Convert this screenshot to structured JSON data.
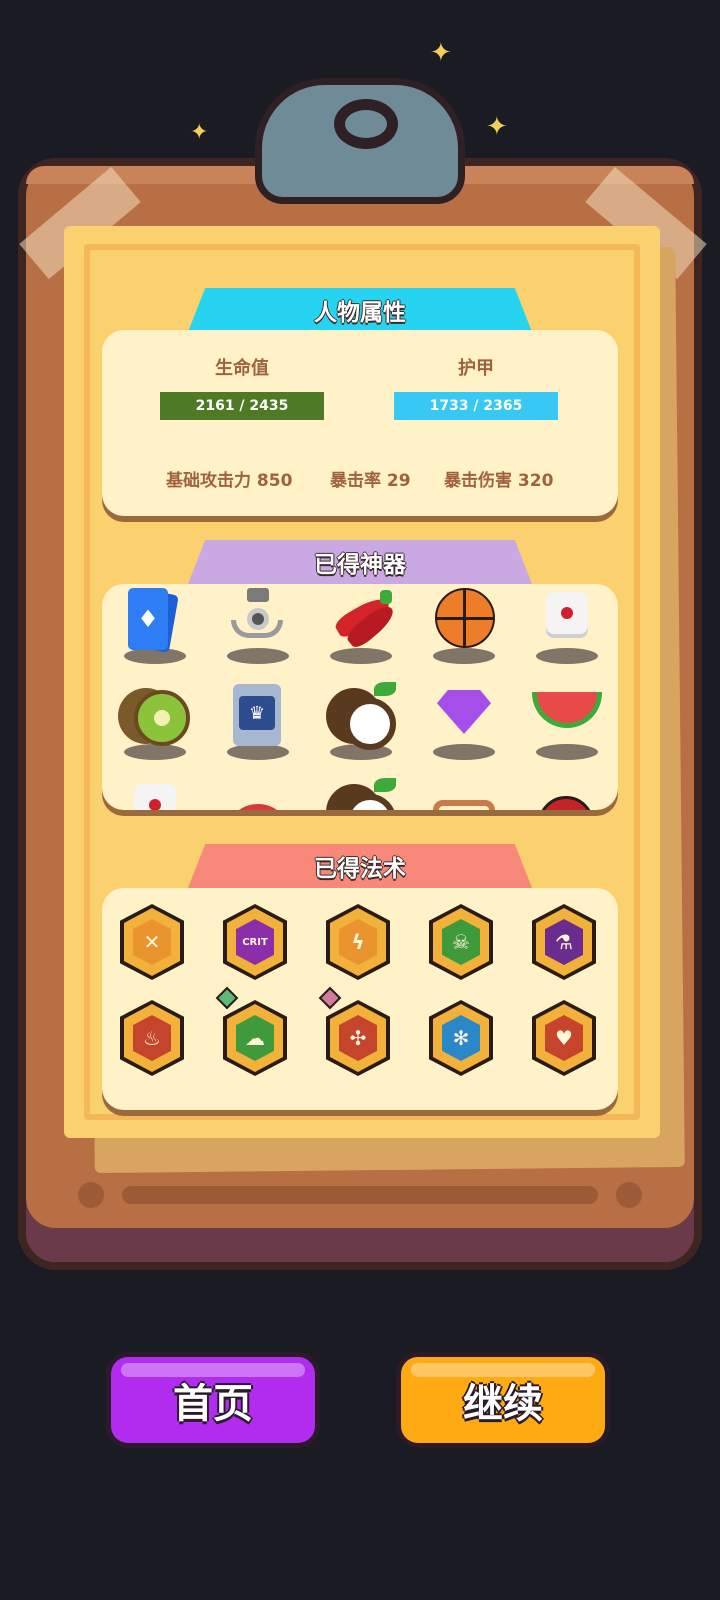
{
  "attributes": {
    "title": "人物属性",
    "hp": {
      "label": "生命值",
      "text": "2161 / 2435",
      "current": 2161,
      "max": 2435,
      "color": "#4e7a26"
    },
    "armor": {
      "label": "护甲",
      "text": "1733 / 2365",
      "current": 1733,
      "max": 2365,
      "color": "#38c8f4"
    },
    "base_attack": "基础攻击力 850",
    "crit_rate": "暴击率 29",
    "crit_damage": "暴击伤害 320"
  },
  "artifacts": {
    "title": "已得神器",
    "items": [
      {
        "icon": "playing-cards-icon"
      },
      {
        "icon": "claw-grabber-icon"
      },
      {
        "icon": "red-chili-peppers-icon"
      },
      {
        "icon": "basketball-icon"
      },
      {
        "icon": "dice-icon"
      },
      {
        "icon": "kiwi-fruit-icon"
      },
      {
        "icon": "crown-bag-icon"
      },
      {
        "icon": "coconut-icon"
      },
      {
        "icon": "purple-gem-icon"
      },
      {
        "icon": "watermelon-slice-icon"
      },
      {
        "icon": "dice-icon"
      },
      {
        "icon": "red-fan-icon"
      },
      {
        "icon": "coconut-icon"
      },
      {
        "icon": "bracelet-icon"
      },
      {
        "icon": "red-helmet-icon"
      }
    ]
  },
  "spells": {
    "title": "已得法术",
    "items": [
      {
        "icon": "crossed-swords-icon",
        "color": "#e9942e"
      },
      {
        "icon": "crit-burst-icon",
        "color": "#8a2fa8",
        "label": "CRIT"
      },
      {
        "icon": "lightning-shield-icon",
        "color": "#e9942e"
      },
      {
        "icon": "skull-burst-icon",
        "color": "#3e9a3a"
      },
      {
        "icon": "potion-shield-icon",
        "color": "#6a2d8f"
      },
      {
        "icon": "fire-shield-icon",
        "color": "#c4452c"
      },
      {
        "icon": "sheep-icon",
        "color": "#3e9a3a",
        "gem": "#5fb87a"
      },
      {
        "icon": "swirl-arrows-icon",
        "color": "#c4452c",
        "gem": "#d47aa0"
      },
      {
        "icon": "snowflake-shield-icon",
        "color": "#2a88c9"
      },
      {
        "icon": "heartbeat-icon",
        "color": "#c4452c"
      }
    ]
  },
  "buttons": {
    "home": "首页",
    "continue": "继续"
  },
  "colors": {
    "home_button": "#b22cf0",
    "continue_button": "#ffaa12",
    "attributes_header": "#26d4f2",
    "artifacts_header": "#c9a8e4",
    "spells_header": "#f7887a"
  }
}
